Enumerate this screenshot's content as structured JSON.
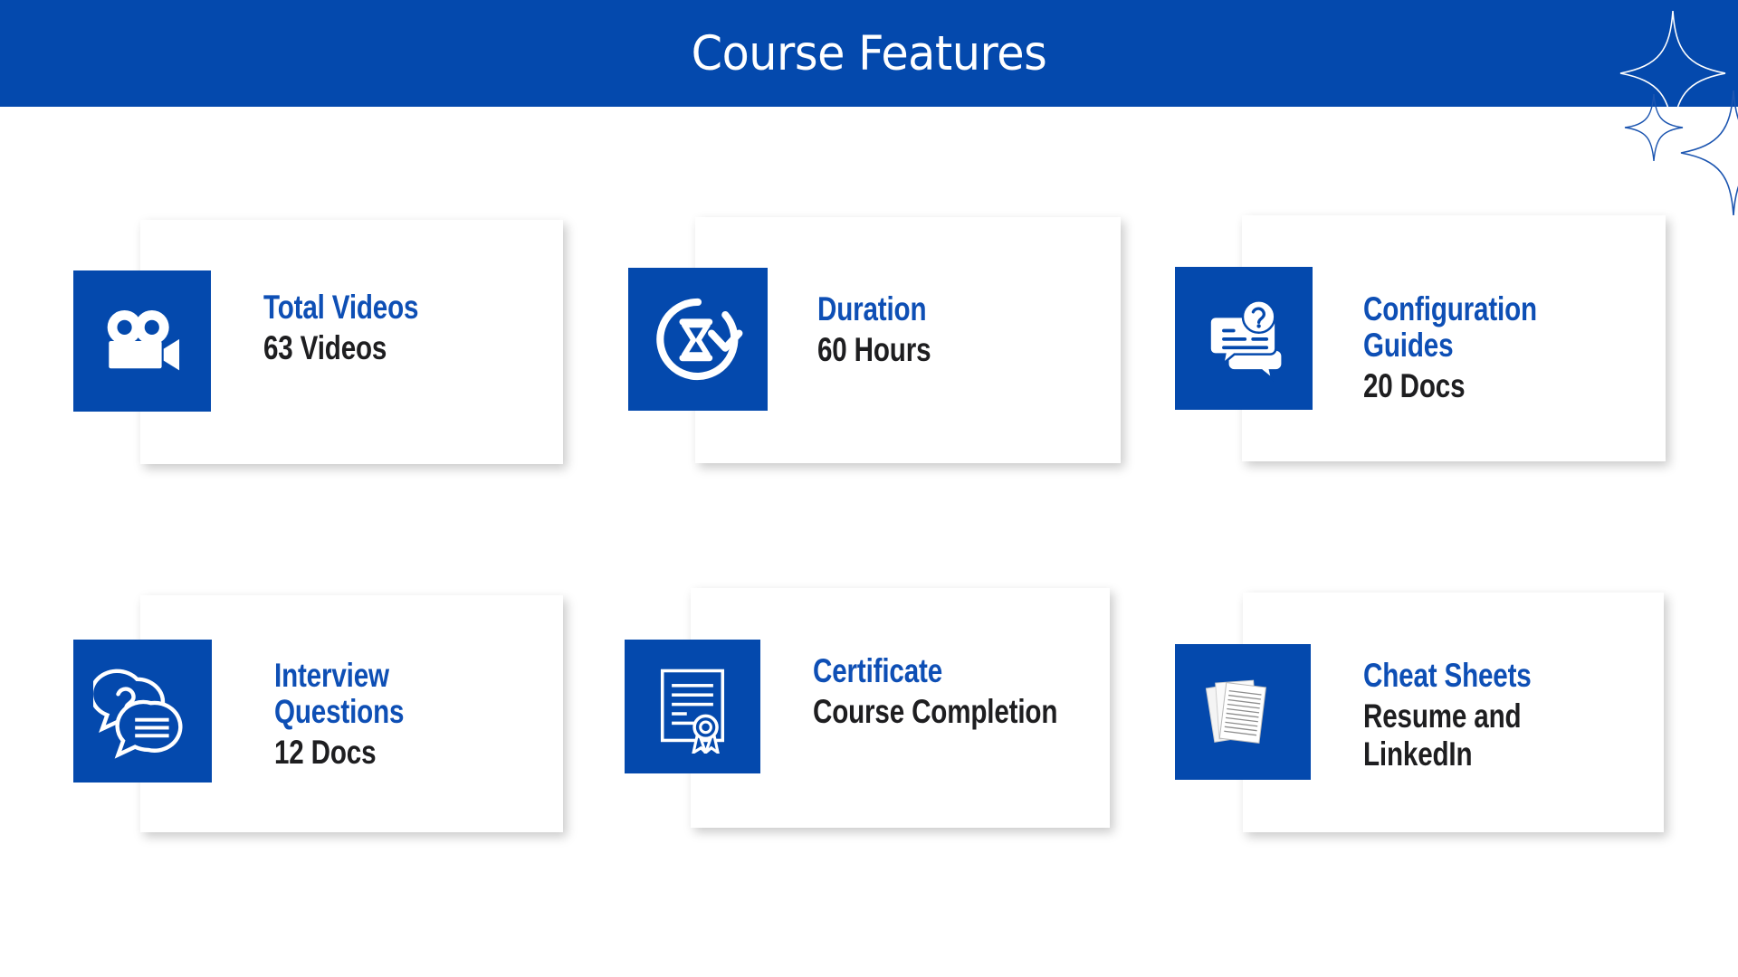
{
  "header": {
    "title": "Course Features",
    "background_color": "#0449AD",
    "text_color": "#FFFFFF"
  },
  "theme": {
    "brand_blue": "#0449AD",
    "title_blue": "#0E4FB5",
    "value_dark": "#1E1E20",
    "page_background": "#FFFFFF"
  },
  "decorations": [
    {
      "name": "sparkle-large-top",
      "stroke": "#FFFFFF"
    },
    {
      "name": "sparkle-small-mid",
      "stroke": "#1C55B0"
    },
    {
      "name": "sparkle-large-bottom",
      "stroke": "#1C55B0"
    }
  ],
  "cards": [
    {
      "icon": "video-camera-icon",
      "title": "Total Videos",
      "value": "63 Videos"
    },
    {
      "icon": "hourglass-refresh-icon",
      "title": "Duration",
      "value": "60 Hours"
    },
    {
      "icon": "document-question-bubble-icon",
      "title": "Configuration Guides",
      "value": "20 Docs"
    },
    {
      "icon": "chat-bubbles-question-icon",
      "title": "Interview Questions",
      "value": "12 Docs"
    },
    {
      "icon": "certificate-ribbon-icon",
      "title": "Certificate",
      "value": "Course Completion"
    },
    {
      "icon": "paper-stack-icon",
      "title": "Cheat Sheets",
      "value": "Resume and\nLinkedIn"
    }
  ]
}
